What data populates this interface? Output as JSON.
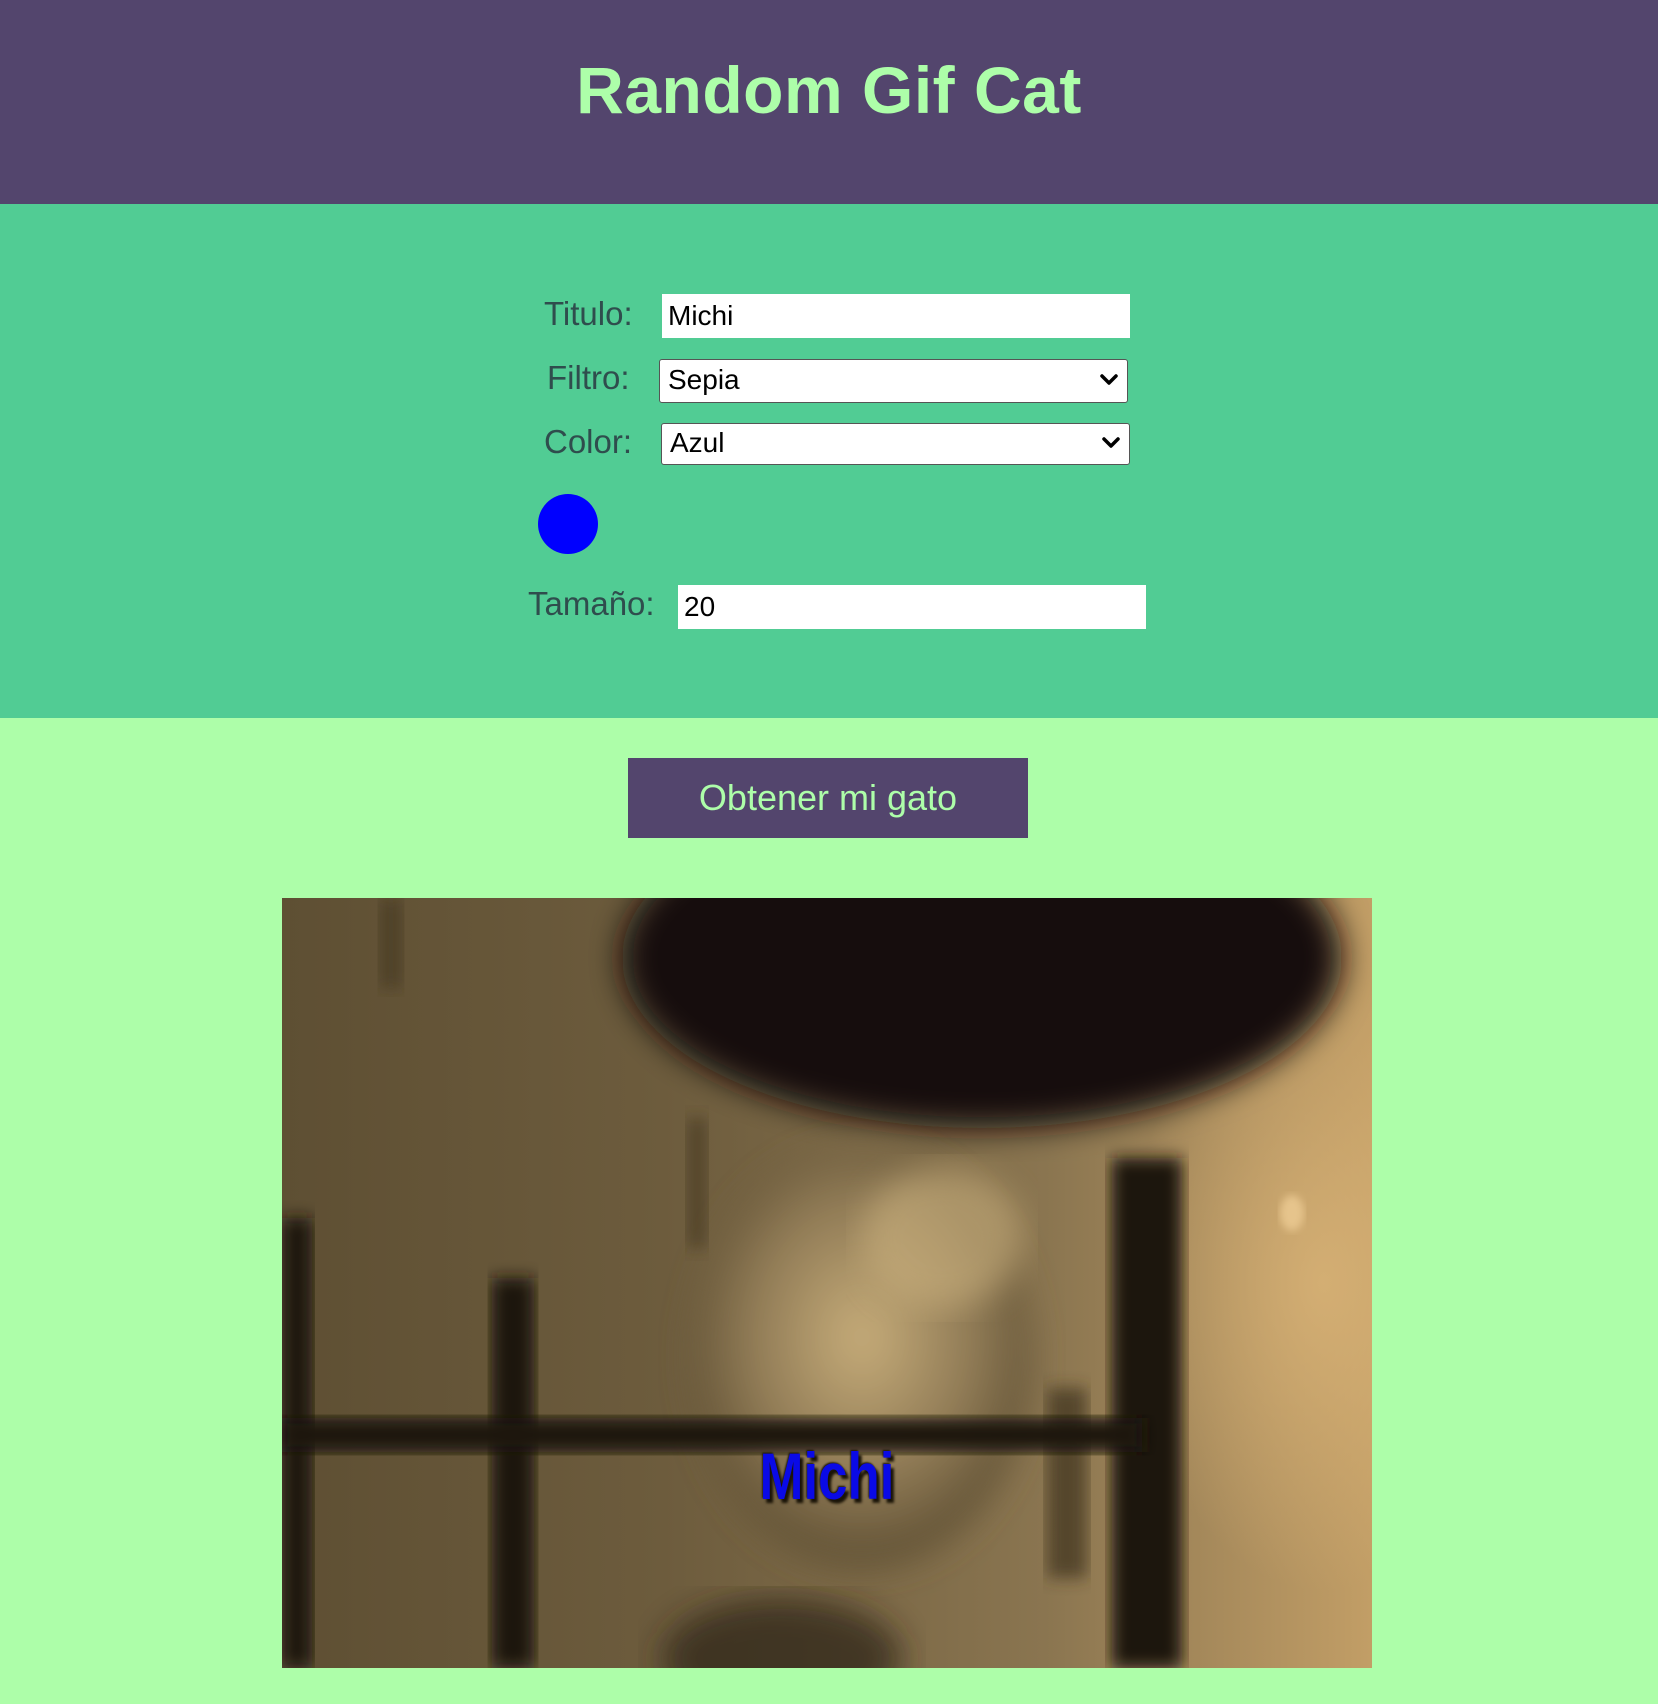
{
  "header": {
    "title": "Random Gif Cat"
  },
  "form": {
    "titulo": {
      "label": "Titulo:",
      "value": "Michi"
    },
    "filtro": {
      "label": "Filtro:",
      "value": "Sepia"
    },
    "color": {
      "label": "Color:",
      "value": "Azul",
      "swatch": "#0000ff"
    },
    "tamano": {
      "label": "Tamaño:",
      "value": "20"
    }
  },
  "action": {
    "button_label": "Obtener mi gato"
  },
  "gif": {
    "caption": "Michi",
    "caption_color": "#0a0ae6"
  },
  "colors": {
    "header_bg": "#53456d",
    "accent_text": "#adfea9",
    "panel_bg": "#51cc94",
    "page_bg": "#adfea9"
  }
}
